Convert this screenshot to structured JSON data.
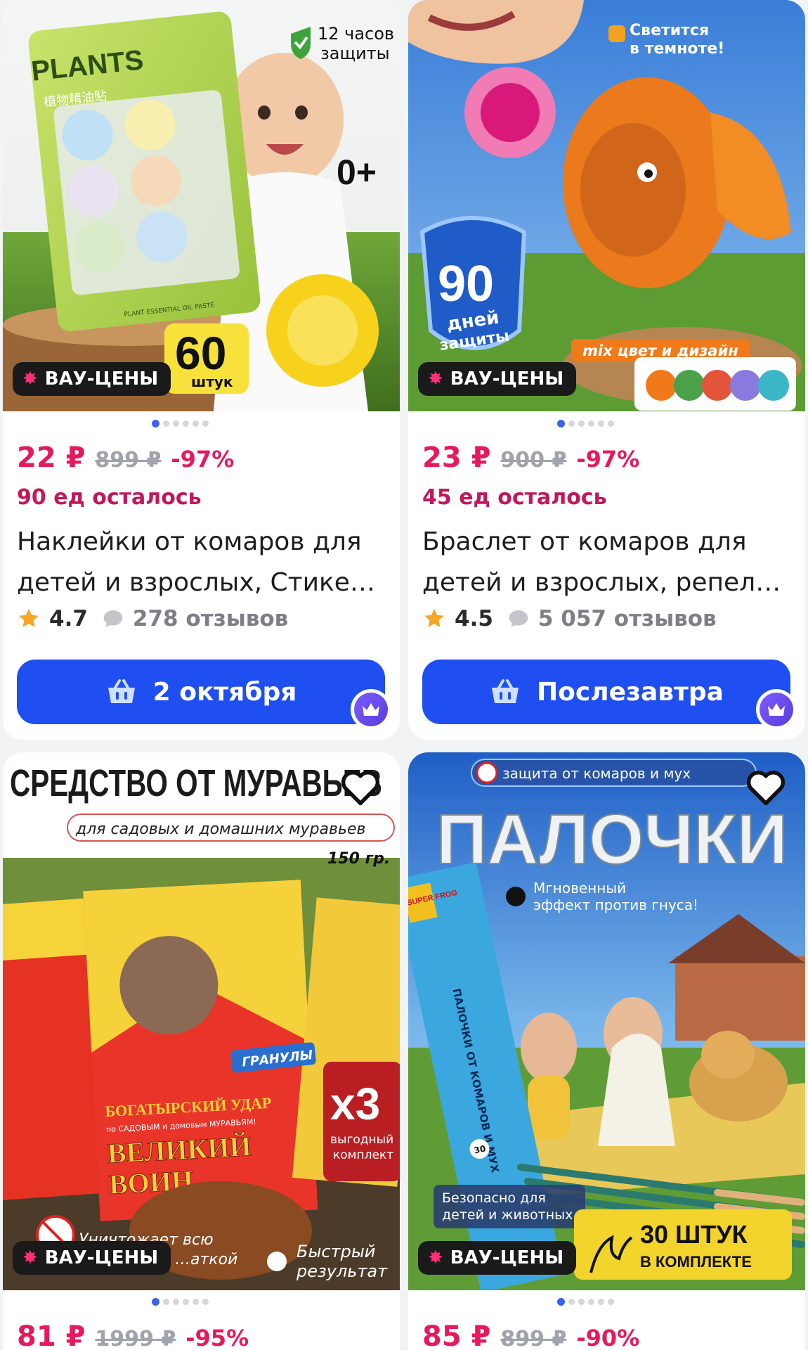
{
  "badge_label": "ВАУ-ЦЕНЫ",
  "products": [
    {
      "price": "22 ₽",
      "old_price": "899 ₽",
      "discount": "-97%",
      "stock": "90 ед осталось",
      "title_line1": "Наклейки от комаров для",
      "title_line2": "детей и взрослых, Стике…",
      "rating": "4.7",
      "reviews": "278 отзывов",
      "delivery": "2 октября",
      "photo_texts": {
        "brand": "PLANTS",
        "hours": "12 часов\nзащиты",
        "hours_1": "12 часов",
        "hours_2": "защиты",
        "age": "0+",
        "count": "60",
        "count_unit": "штук",
        "chinese": "植物精油贴",
        "pack_caption": "PLANT ESSENTIAL OIL PASTE"
      }
    },
    {
      "price": "23 ₽",
      "old_price": "900 ₽",
      "discount": "-97%",
      "stock": "45 ед осталось",
      "title_line1": "Браслет от комаров для",
      "title_line2": "детей и взрослых, репел…",
      "rating": "4.5",
      "reviews": "5 057 отзывов",
      "delivery": "Послезавтра",
      "photo_texts": {
        "glow_1": "Светится",
        "glow_2": "в темноте!",
        "days_num": "90",
        "days_1": "дней",
        "days_2": "защиты",
        "mix": "mix цвет и дизайн"
      }
    },
    {
      "price": "81 ₽",
      "old_price": "1999 ₽",
      "discount": "-95%",
      "photo_texts": {
        "headline": "СРЕДСТВО ОТ МУРАВЬЕВ",
        "sub": "для садовых и домашних муравьев",
        "weight": "150 гр.",
        "granules": "ГРАНУЛЫ",
        "x3": "х3",
        "deal_1": "выгодный",
        "deal_2": "комплект",
        "pack_brand": "БОГАТЫРСКИЙ УДАР",
        "pack_sub": "по САДОВЫМ и домовым МУРАВЬЯМ!",
        "pack_name_1": "ВЕЛИКИЙ",
        "pack_name_2": "ВОИН",
        "destroy_1": "Уничтожает всю",
        "destroy_2": "…аткой",
        "fast_1": "Быстрый",
        "fast_2": "результат"
      }
    },
    {
      "price": "85 ₽",
      "old_price": "899 ₽",
      "discount": "-90%",
      "photo_texts": {
        "top": "защита от комаров и мух",
        "headline": "ПАЛОЧКИ",
        "instant_1": "Мгновенный",
        "instant_2": "эффект против гнуса!",
        "box_brand": "SUPER FROG",
        "box_text": "ПАЛОЧКИ ОТ КОМАРОВ И МУХ",
        "box_count": "30",
        "safe_1": "Безопасно для",
        "safe_2": "детей и животных",
        "count_1": "30 ШТУК",
        "count_2": "В КОМПЛЕКТЕ"
      }
    }
  ]
}
